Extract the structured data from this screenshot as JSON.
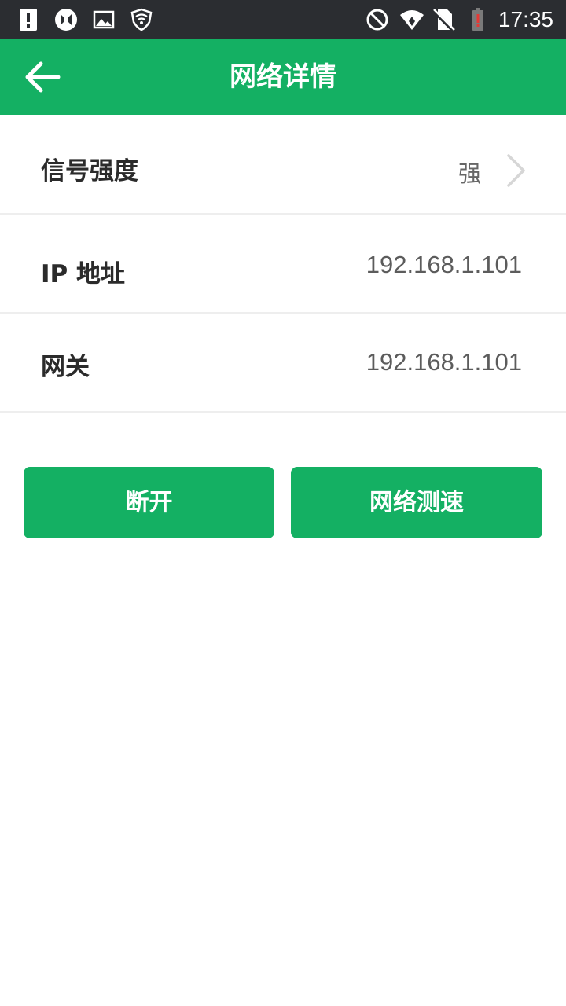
{
  "status_bar": {
    "time": "17:35",
    "left_icons": [
      "alert-icon",
      "sync-app-icon",
      "gallery-icon",
      "shield-wifi-icon"
    ],
    "right_icons": [
      "do-not-disturb-icon",
      "wifi-signal-icon",
      "no-sim-icon",
      "battery-low-icon"
    ]
  },
  "app_bar": {
    "title": "网络详情",
    "back_icon": "arrow-left-icon",
    "color": "#14b063"
  },
  "details": {
    "signal": {
      "label": "信号强度",
      "value": "强"
    },
    "ip": {
      "label": "IP 地址",
      "value": "192.168.1.101"
    },
    "gateway": {
      "label": "网关",
      "value": "192.168.1.101"
    }
  },
  "actions": {
    "disconnect_label": "断开",
    "speed_test_label": "网络测速"
  }
}
